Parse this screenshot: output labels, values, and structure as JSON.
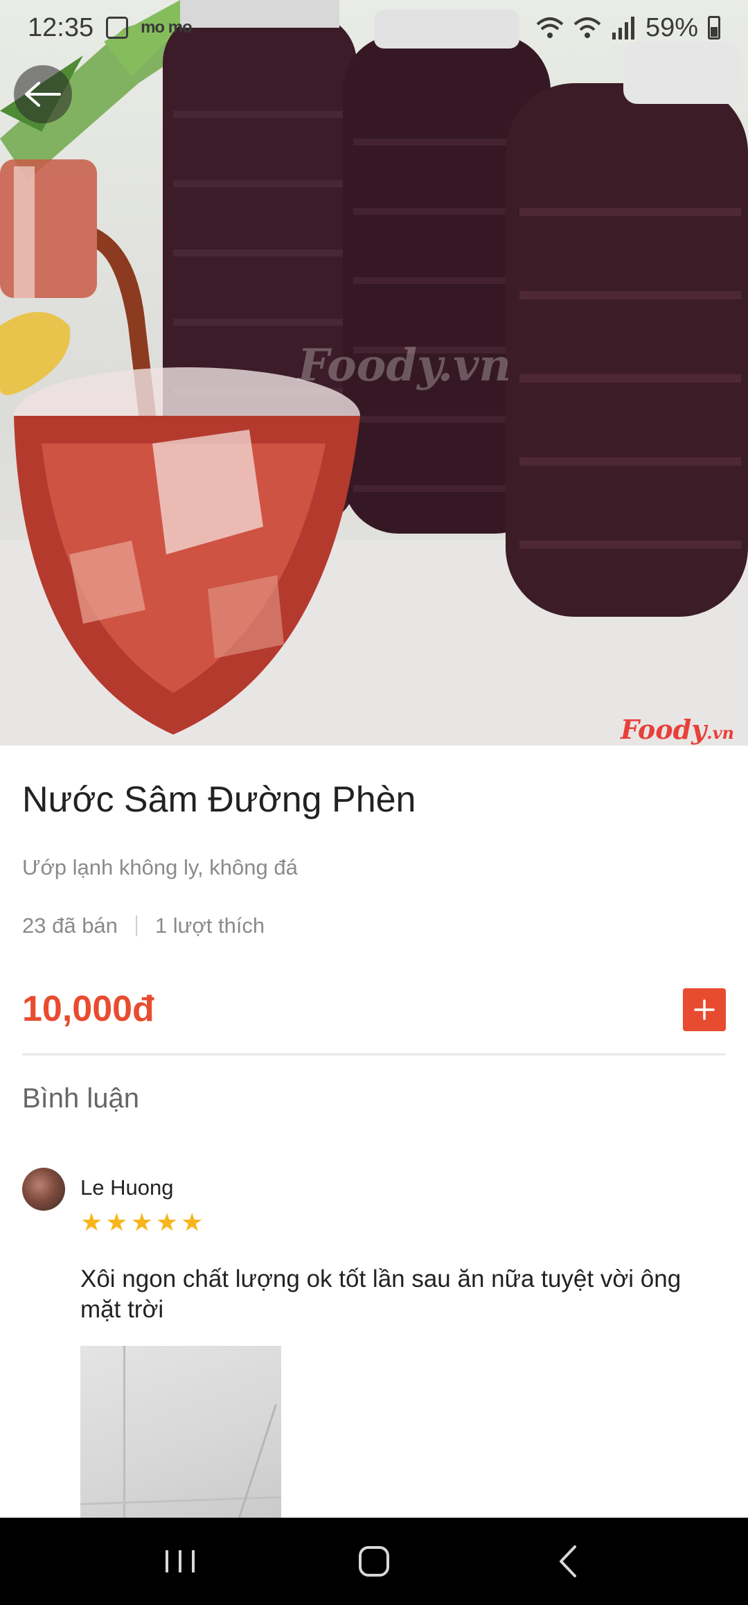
{
  "status_bar": {
    "time": "12:35",
    "notification_text": "mo mo",
    "battery": "59%"
  },
  "hero": {
    "watermark_main": "Foody",
    "watermark_suffix": ".vn",
    "watermark_center": "Foody.vn"
  },
  "product": {
    "title": "Nước Sâm Đường Phèn",
    "subtitle": "Ướp lạnh không ly, không đá",
    "sold": "23 đã bán",
    "likes": "1 lượt thích",
    "price": "10,000đ"
  },
  "comments": {
    "heading": "Bình luận",
    "items": [
      {
        "author": "Le Huong",
        "rating": 5,
        "stars": "★★★★★",
        "text": "Xôi ngon chất lượng ok tốt lần sau ăn nữa tuyệt vời ông mặt trời"
      }
    ]
  },
  "colors": {
    "accent": "#e84c30",
    "star": "#f7b51c",
    "muted_text": "#8a8a8a"
  },
  "icons": {
    "back": "arrow-left-icon",
    "add": "plus-icon",
    "nav_recent": "recent-apps-icon",
    "nav_home": "home-icon",
    "nav_back": "chevron-left-icon"
  }
}
